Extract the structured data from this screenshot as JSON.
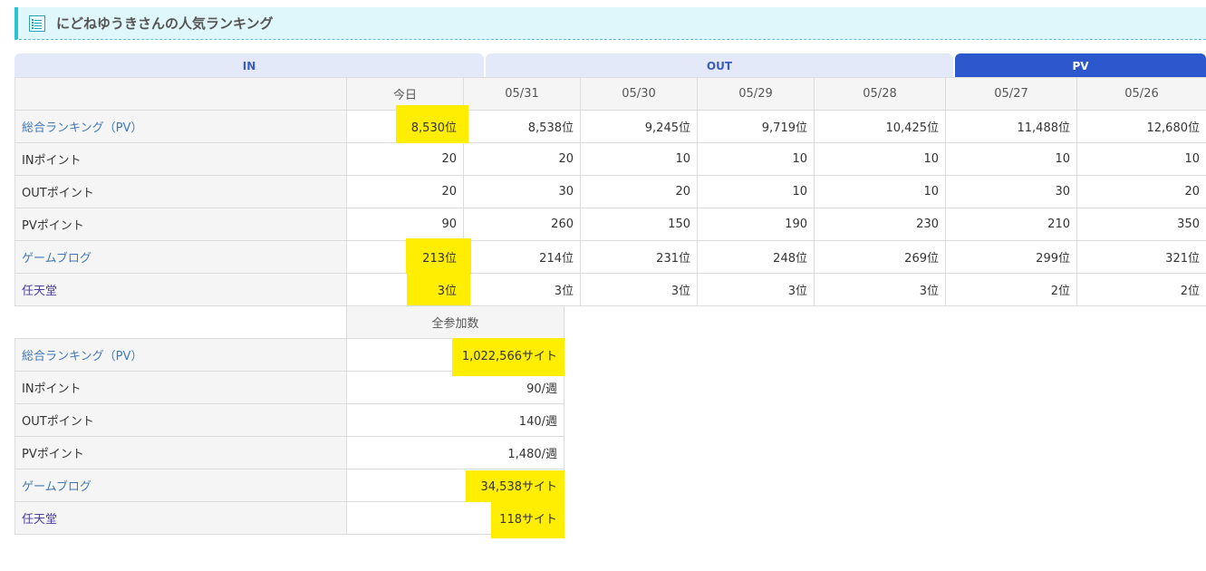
{
  "header": {
    "title": "にどねゆうきさんの人気ランキング"
  },
  "tabs": [
    {
      "label": "IN",
      "active": false
    },
    {
      "label": "OUT",
      "active": false
    },
    {
      "label": "PV",
      "active": true
    }
  ],
  "colors": {
    "accent": "#2b58cc",
    "highlight": "#ffee00",
    "header_bg": "#dff7fa"
  },
  "ranking_table": {
    "columns": [
      "今日",
      "05/31",
      "05/30",
      "05/29",
      "05/28",
      "05/27",
      "05/26"
    ],
    "rows": [
      {
        "label": "総合ランキング（PV）",
        "values": [
          "8,530位",
          "8,538位",
          "9,245位",
          "9,719位",
          "10,425位",
          "11,488位",
          "12,680位"
        ]
      },
      {
        "label": "INポイント",
        "values": [
          "20",
          "20",
          "10",
          "10",
          "10",
          "10",
          "10"
        ]
      },
      {
        "label": "OUTポイント",
        "values": [
          "20",
          "30",
          "20",
          "10",
          "10",
          "30",
          "20"
        ]
      },
      {
        "label": "PVポイント",
        "values": [
          "90",
          "260",
          "150",
          "190",
          "230",
          "210",
          "350"
        ]
      },
      {
        "label": "ゲームブログ",
        "values": [
          "213位",
          "214位",
          "231位",
          "248位",
          "269位",
          "299位",
          "321位"
        ]
      },
      {
        "label": "任天堂",
        "values": [
          "3位",
          "3位",
          "3位",
          "3位",
          "3位",
          "2位",
          "2位"
        ]
      }
    ]
  },
  "totals_table": {
    "column": "全参加数",
    "rows": [
      {
        "label": "総合ランキング（PV）",
        "value": "1,022,566サイト"
      },
      {
        "label": "INポイント",
        "value": "90/週"
      },
      {
        "label": "OUTポイント",
        "value": "140/週"
      },
      {
        "label": "PVポイント",
        "value": "1,480/週"
      },
      {
        "label": "ゲームブログ",
        "value": "34,538サイト"
      },
      {
        "label": "任天堂",
        "value": "118サイト"
      }
    ]
  }
}
